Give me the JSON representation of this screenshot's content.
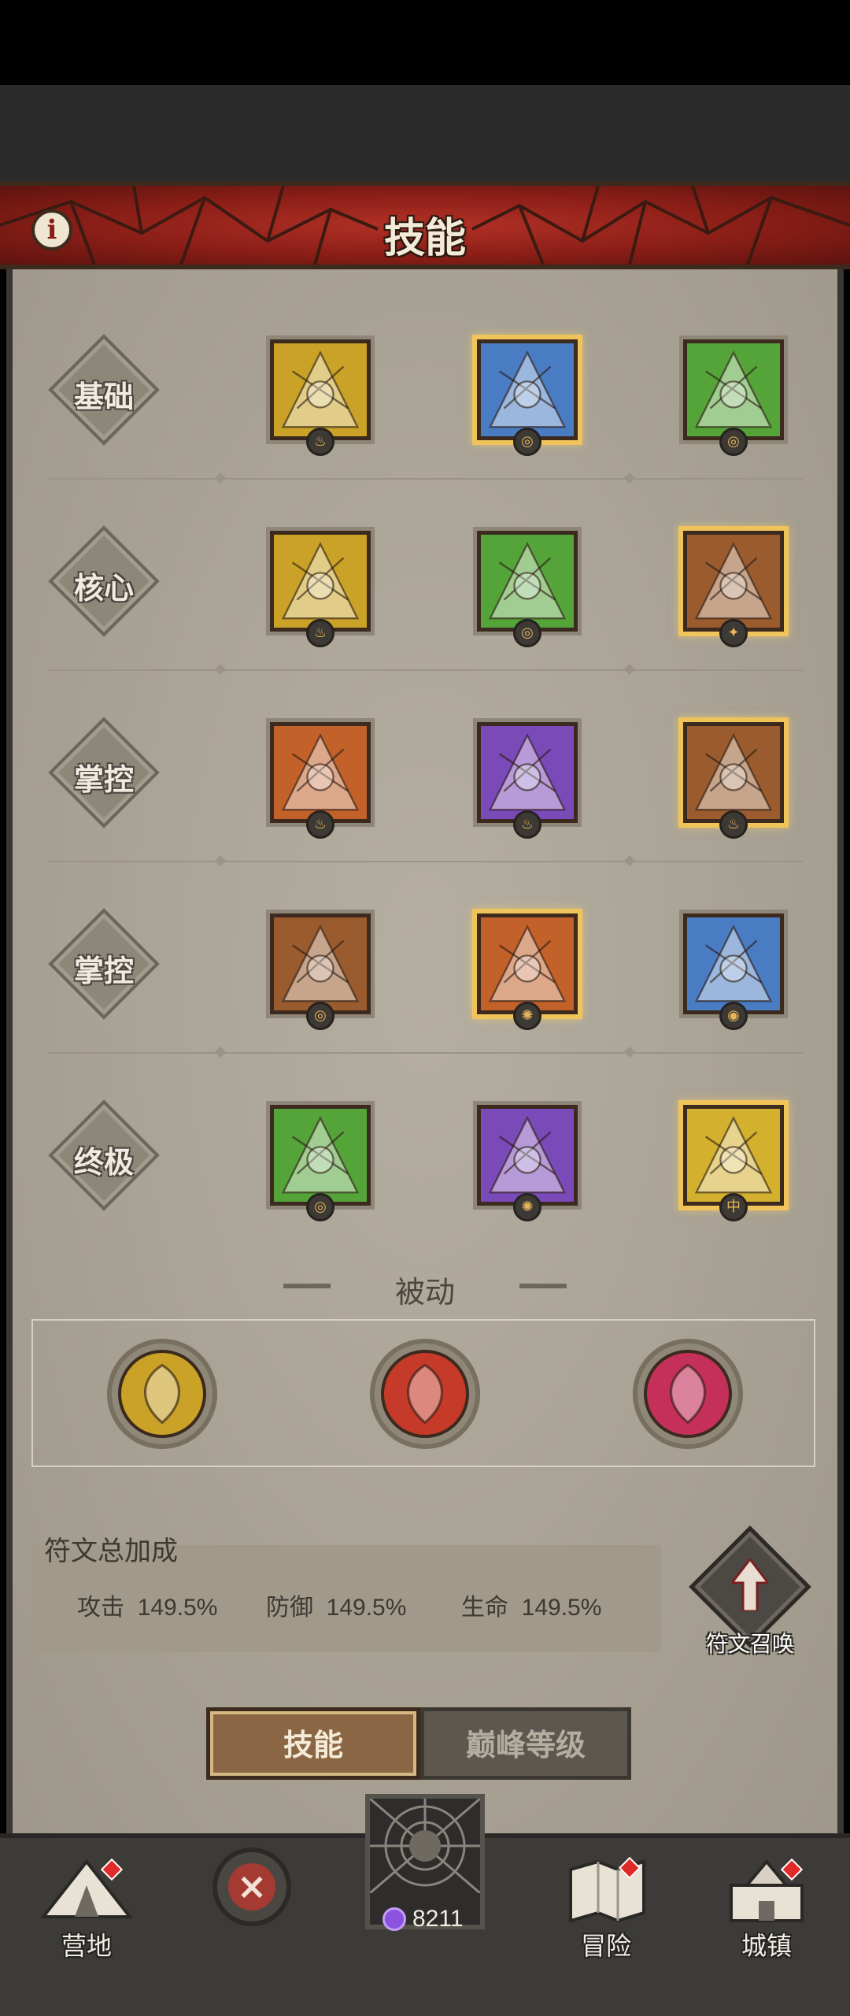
{
  "header": {
    "title": "技能",
    "info_icon": "info-icon"
  },
  "rows": [
    {
      "label": "基础",
      "skills": [
        {
          "icon": "golden-axe-skill-icon",
          "color": "#c9a227",
          "badge": "fire"
        },
        {
          "icon": "ice-axe-skill-icon",
          "color": "#4a7cc4",
          "badge": "swirl",
          "selected": true
        },
        {
          "icon": "green-slash-skill-icon",
          "color": "#55a43a",
          "badge": "swirl"
        }
      ]
    },
    {
      "label": "核心",
      "skills": [
        {
          "icon": "golden-whirlwind-skill-icon",
          "color": "#c9a227",
          "badge": "fire"
        },
        {
          "icon": "green-burst-skill-icon",
          "color": "#55a43a",
          "badge": "swirl"
        },
        {
          "icon": "stone-totem-skill-icon",
          "color": "#9a5b2e",
          "badge": "purple-flame",
          "selected": true
        }
      ]
    },
    {
      "label": "掌控",
      "skills": [
        {
          "icon": "flaming-comet-skill-icon",
          "color": "#c2612a",
          "badge": "fire"
        },
        {
          "icon": "purple-storm-skill-icon",
          "color": "#7a4ab8",
          "badge": "fire"
        },
        {
          "icon": "earth-hammer-skill-icon",
          "color": "#9a5b2e",
          "badge": "fire",
          "selected": true
        }
      ]
    },
    {
      "label": "掌控",
      "skills": [
        {
          "icon": "brown-fist-skill-icon",
          "color": "#9a5b2e",
          "badge": "swirl"
        },
        {
          "icon": "roaring-spirit-skill-icon",
          "color": "#c2612a",
          "badge": "sparkle",
          "selected": true
        },
        {
          "icon": "ice-spirit-skill-icon",
          "color": "#4a7cc4",
          "badge": "eye"
        }
      ]
    },
    {
      "label": "终极",
      "skills": [
        {
          "icon": "green-cyclone-skill-icon",
          "color": "#55a43a",
          "badge": "swirl"
        },
        {
          "icon": "purple-demon-skill-icon",
          "color": "#7a4ab8",
          "badge": "sparkle"
        },
        {
          "icon": "golden-guardian-skill-icon",
          "color": "#d4b02f",
          "badge": "center",
          "selected": true
        }
      ]
    }
  ],
  "passive": {
    "title": "被动",
    "items": [
      {
        "icon": "golden-axe-passive-icon",
        "color": "#c9a227"
      },
      {
        "icon": "fire-spirit-passive-icon",
        "color": "#c63a2a"
      },
      {
        "icon": "bleeding-heart-passive-icon",
        "color": "#c4305a"
      }
    ]
  },
  "rune": {
    "title": "符文总加成",
    "stats": [
      {
        "label": "攻击",
        "value": "149.5%"
      },
      {
        "label": "防御",
        "value": "149.5%"
      },
      {
        "label": "生命",
        "value": "149.5%"
      }
    ],
    "summon_label": "符文召唤"
  },
  "tabs": {
    "active": "技能",
    "inactive": "巅峰等级"
  },
  "nav": {
    "camp": "营地",
    "adventure": "冒险",
    "town": "城镇",
    "currency": "8211"
  },
  "colors": {
    "banner": "#8a1e17",
    "panel": "#aca596",
    "selected_glow": "#f1c45b",
    "nav_bg": "#3d3b38"
  }
}
